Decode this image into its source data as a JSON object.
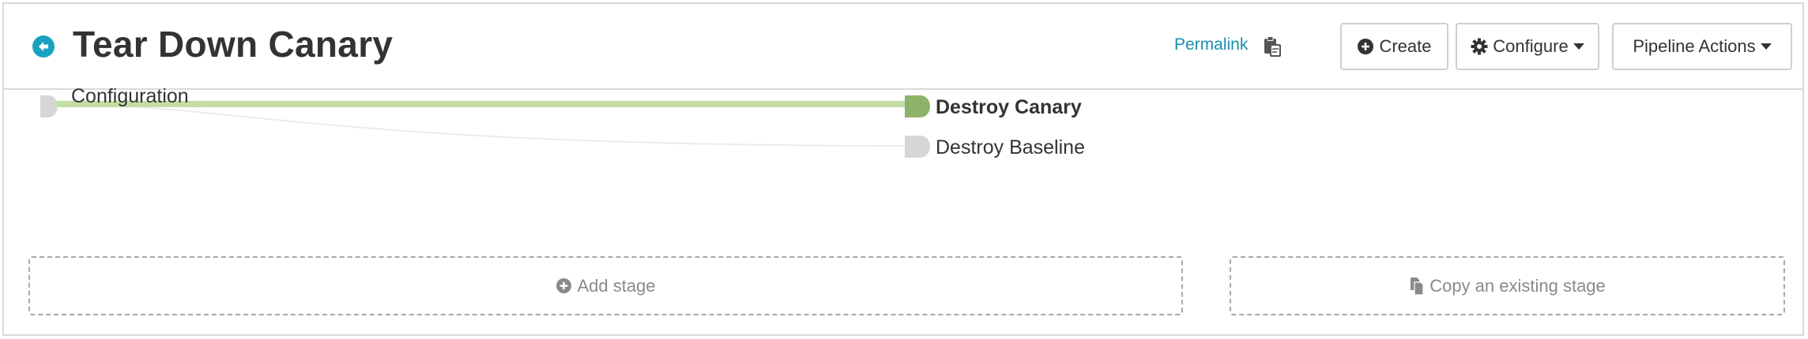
{
  "header": {
    "title": "Tear Down Canary",
    "permalink_label": "Permalink",
    "buttons": {
      "create": "Create",
      "configure": "Configure",
      "pipeline_actions": "Pipeline Actions"
    }
  },
  "graph": {
    "nodes": {
      "configuration": "Configuration",
      "destroy_canary": "Destroy Canary",
      "destroy_baseline": "Destroy Baseline"
    },
    "colors": {
      "active_edge": "#c3dea2",
      "active_node": "#8db26a",
      "inactive_node": "#d6d6d6",
      "inactive_edge": "#ececec"
    }
  },
  "actions": {
    "add_stage": "Add stage",
    "copy_stage": "Copy an existing stage"
  },
  "icons": {
    "back": "arrow-left-circle-icon",
    "clipboard": "clipboard-icon",
    "create": "plus-circle-icon",
    "configure": "gear-icon",
    "copy": "copy-icon"
  }
}
